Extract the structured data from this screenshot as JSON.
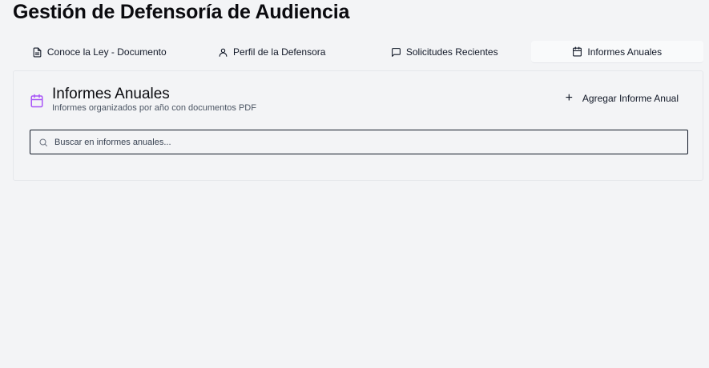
{
  "page": {
    "title": "Gestión de Defensoría de Audiencia"
  },
  "tabs": [
    {
      "label": "Conoce la Ley - Documento",
      "icon": "document-icon"
    },
    {
      "label": "Perfil de la Defensora",
      "icon": "user-icon"
    },
    {
      "label": "Solicitudes Recientes",
      "icon": "message-icon"
    },
    {
      "label": "Informes Anuales",
      "icon": "calendar-icon",
      "active": true
    }
  ],
  "card": {
    "title": "Informes Anuales",
    "subtitle": "Informes organizados por año con documentos PDF",
    "icon": "calendar-icon",
    "accent_color": "#a855f7",
    "add_button_label": "Agregar Informe Anual"
  },
  "search": {
    "placeholder": "Buscar en informes anuales...",
    "value": ""
  }
}
